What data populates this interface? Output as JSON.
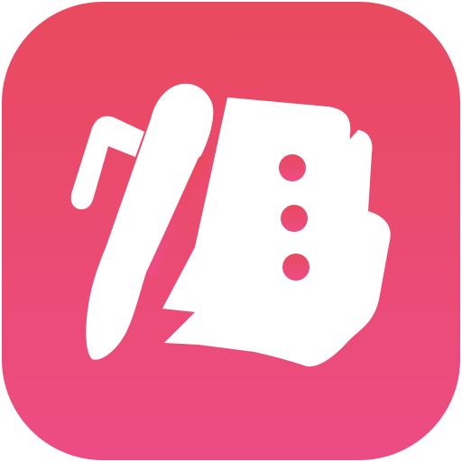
{
  "icon": {
    "name": "notes-list-with-pen-app-icon",
    "glyph": "notes-checklist-pen-icon",
    "background_top_color": "#E94A5E",
    "background_bottom_color": "#EC4C84",
    "glyph_color": "#FFFFFF",
    "checklist_rows": 3
  }
}
